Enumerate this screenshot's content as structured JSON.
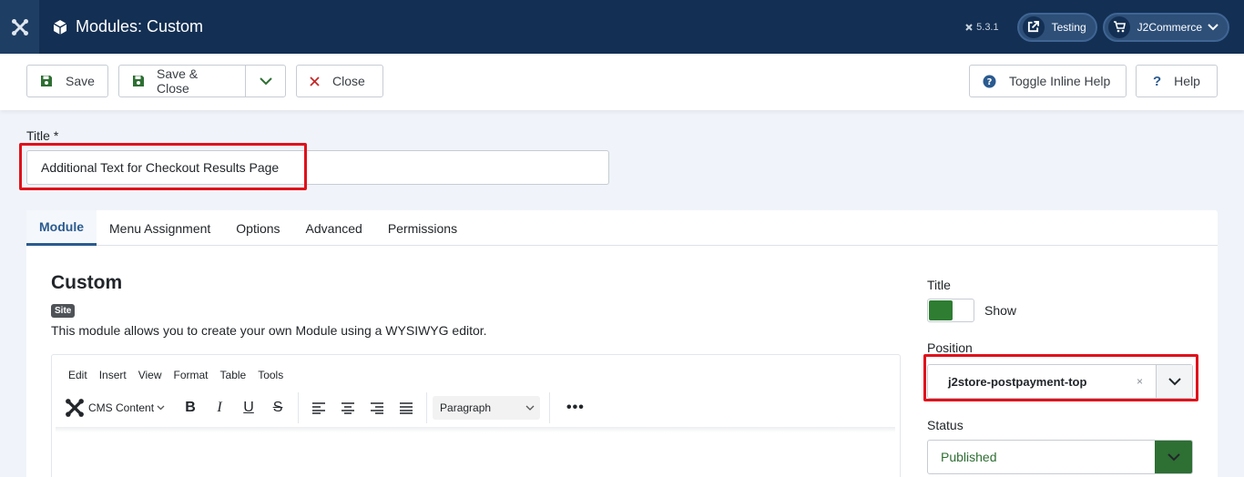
{
  "header": {
    "page_title": "Modules: Custom",
    "version": "5.3.1",
    "site_link_label": "Testing",
    "user_menu_label": "J2Commerce",
    "icons": {
      "logo": "joomla-logo-icon",
      "module": "cube-icon",
      "external": "external-link-icon",
      "cart": "cart-icon",
      "chevron": "chevron-down-icon"
    },
    "colors": {
      "bar": "#132f53",
      "logo_box": "#1f3e64"
    }
  },
  "toolbar": {
    "save_label": "Save",
    "save_close_label": "Save & Close",
    "close_label": "Close",
    "inline_help_label": "Toggle Inline Help",
    "help_label": "Help"
  },
  "form": {
    "title_label": "Title *",
    "title_value": "Additional Text for Checkout Results Page"
  },
  "tabs": [
    {
      "label": "Module",
      "active": true
    },
    {
      "label": "Menu Assignment",
      "active": false
    },
    {
      "label": "Options",
      "active": false
    },
    {
      "label": "Advanced",
      "active": false
    },
    {
      "label": "Permissions",
      "active": false
    }
  ],
  "module": {
    "heading": "Custom",
    "badge": "Site",
    "description": "This module allows you to create your own Module using a WYSIWYG editor."
  },
  "editor": {
    "menu": [
      "Edit",
      "Insert",
      "View",
      "Format",
      "Table",
      "Tools"
    ],
    "cms_content_label": "CMS Content",
    "bold": "B",
    "italic": "I",
    "underline": "U",
    "strike": "S",
    "block_format": "Paragraph",
    "more": "•••"
  },
  "sidebar": {
    "title_label": "Title",
    "title_toggle_label": "Show",
    "position_label": "Position",
    "position_value": "j2store-postpayment-top",
    "position_clear": "×",
    "status_label": "Status",
    "status_value": "Published",
    "colors": {
      "published": "#2e6f33",
      "toggle_on": "#2e7d32",
      "highlight": "#e0101b"
    }
  }
}
